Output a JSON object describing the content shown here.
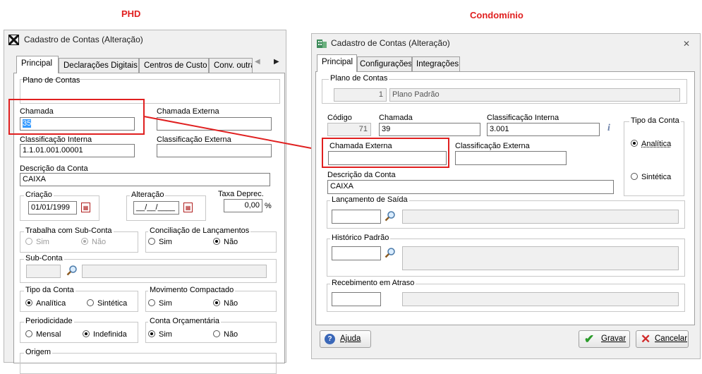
{
  "headings": {
    "left": "PHD",
    "right": "Condomínio"
  },
  "phd": {
    "title": "Cadastro de Contas (Alteração)",
    "tabs": [
      "Principal",
      "Declarações Digitais",
      "Centros de Custo",
      "Conv. outra"
    ],
    "plano_de_contas_label": "Plano de Contas",
    "chamada_label": "Chamada",
    "chamada_value": "35",
    "chamada_externa_label": "Chamada Externa",
    "classificacao_interna_label": "Classificação Interna",
    "classificacao_interna_value": "1.1.01.001.00001",
    "classificacao_externa_label": "Classificação Externa",
    "descricao_label": "Descrição da Conta",
    "descricao_value": "CAIXA",
    "criacao_label": "Criação",
    "criacao_value": "01/01/1999",
    "alteracao_label": "Alteração",
    "alteracao_value": "__/__/____",
    "taxa_label": "Taxa Deprec.",
    "taxa_value": "0,00",
    "taxa_unit": "%",
    "subconta_group": "Trabalha com Sub-Conta",
    "conciliacao_group": "Conciliação de Lançamentos",
    "sim": "Sim",
    "nao": "Não",
    "subconta_label": "Sub-Conta",
    "tipo_group": "Tipo da Conta",
    "analitica": "Analítica",
    "sintetica": "Sintética",
    "movimento_group": "Movimento Compactado",
    "periodicidade_group": "Periodicidade",
    "mensal": "Mensal",
    "indefinida": "Indefinida",
    "orcamentaria_group": "Conta Orçamentária",
    "origem_group": "Origem"
  },
  "condo": {
    "title": "Cadastro de Contas (Alteração)",
    "tabs": [
      "Principal",
      "Configurações",
      "Integrações"
    ],
    "plano_de_contas_label": "Plano de Contas",
    "plano_code": "1",
    "plano_name": "Plano Padrão",
    "codigo_label": "Código",
    "codigo_value": "71",
    "chamada_label": "Chamada",
    "chamada_value": "39",
    "classificacao_interna_label": "Classificação Interna",
    "classificacao_interna_value": "3.001",
    "tipo_group": "Tipo da Conta",
    "analitica": "Analítica",
    "sintetica": "Sintética",
    "chamada_externa_label": "Chamada Externa",
    "classificacao_externa_label": "Classificação Externa",
    "descricao_label": "Descrição da Conta",
    "descricao_value": "CAIXA",
    "lancamento_group": "Lançamento de Saída",
    "historico_group": "Histórico Padrão",
    "recebimento_group": "Recebimento em Atraso",
    "ajuda_label": "Ajuda",
    "gravar_label": "Gravar",
    "cancelar_label": "Cancelar"
  },
  "colors": {
    "highlight": "#e02020",
    "selection": "#3399ff"
  }
}
